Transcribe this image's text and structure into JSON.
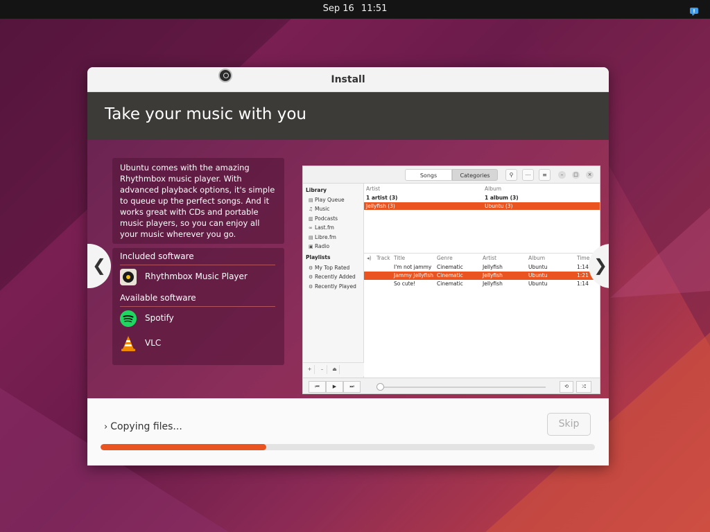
{
  "topbar": {
    "date": "Sep 16",
    "time": "11:51",
    "notification_icon": "notification-icon"
  },
  "window": {
    "title": "Install",
    "app_icon": "installer-icon"
  },
  "slide": {
    "title": "Take your music with you",
    "description": "Ubuntu comes with the amazing Rhythmbox music player. With advanced playback options, it's simple to queue up the perfect songs. And it works great with CDs and portable music players, so you can enjoy all your music wherever you go.",
    "included_heading": "Included software",
    "included": [
      {
        "label": "Rhythmbox Music Player",
        "icon": "rhythmbox-icon"
      }
    ],
    "available_heading": "Available software",
    "available": [
      {
        "label": "Spotify",
        "icon": "spotify-icon"
      },
      {
        "label": "VLC",
        "icon": "vlc-icon"
      }
    ],
    "prev_glyph": "❮",
    "next_glyph": "❯"
  },
  "rhythmbox": {
    "tabs": [
      "Songs",
      "Categories"
    ],
    "library_heading": "Library",
    "library_items": [
      "Play Queue",
      "Music",
      "Podcasts",
      "Last.fm",
      "Libre.fm",
      "Radio"
    ],
    "playlists_heading": "Playlists",
    "playlist_items": [
      "My Top Rated",
      "Recently Added",
      "Recently Played"
    ],
    "artist_header": "Artist",
    "album_header": "Album",
    "artist_summary": "1 artist (3)",
    "album_summary": "1 album (3)",
    "artist_selected": "Jellyfish (3)",
    "album_selected": "Ubuntu (3)",
    "track_columns": [
      "Track",
      "Title",
      "Genre",
      "Artist",
      "Album",
      "Time"
    ],
    "tracks": [
      {
        "title": "I'm not jammy",
        "genre": "Cinematic",
        "artist": "Jellyfish",
        "album": "Ubuntu",
        "time": "1:14"
      },
      {
        "title": "Jammy Jellyfish",
        "genre": "Cinematic",
        "artist": "Jellyfish",
        "album": "Ubuntu",
        "time": "1:21"
      },
      {
        "title": "So cute!",
        "genre": "Cinematic",
        "artist": "Jellyfish",
        "album": "Ubuntu",
        "time": "1:14"
      }
    ]
  },
  "footer": {
    "status": "Copying files...",
    "skip_label": "Skip",
    "progress": 0.335
  },
  "colors": {
    "accent": "#e95420",
    "header_bg": "#3c3b37"
  }
}
